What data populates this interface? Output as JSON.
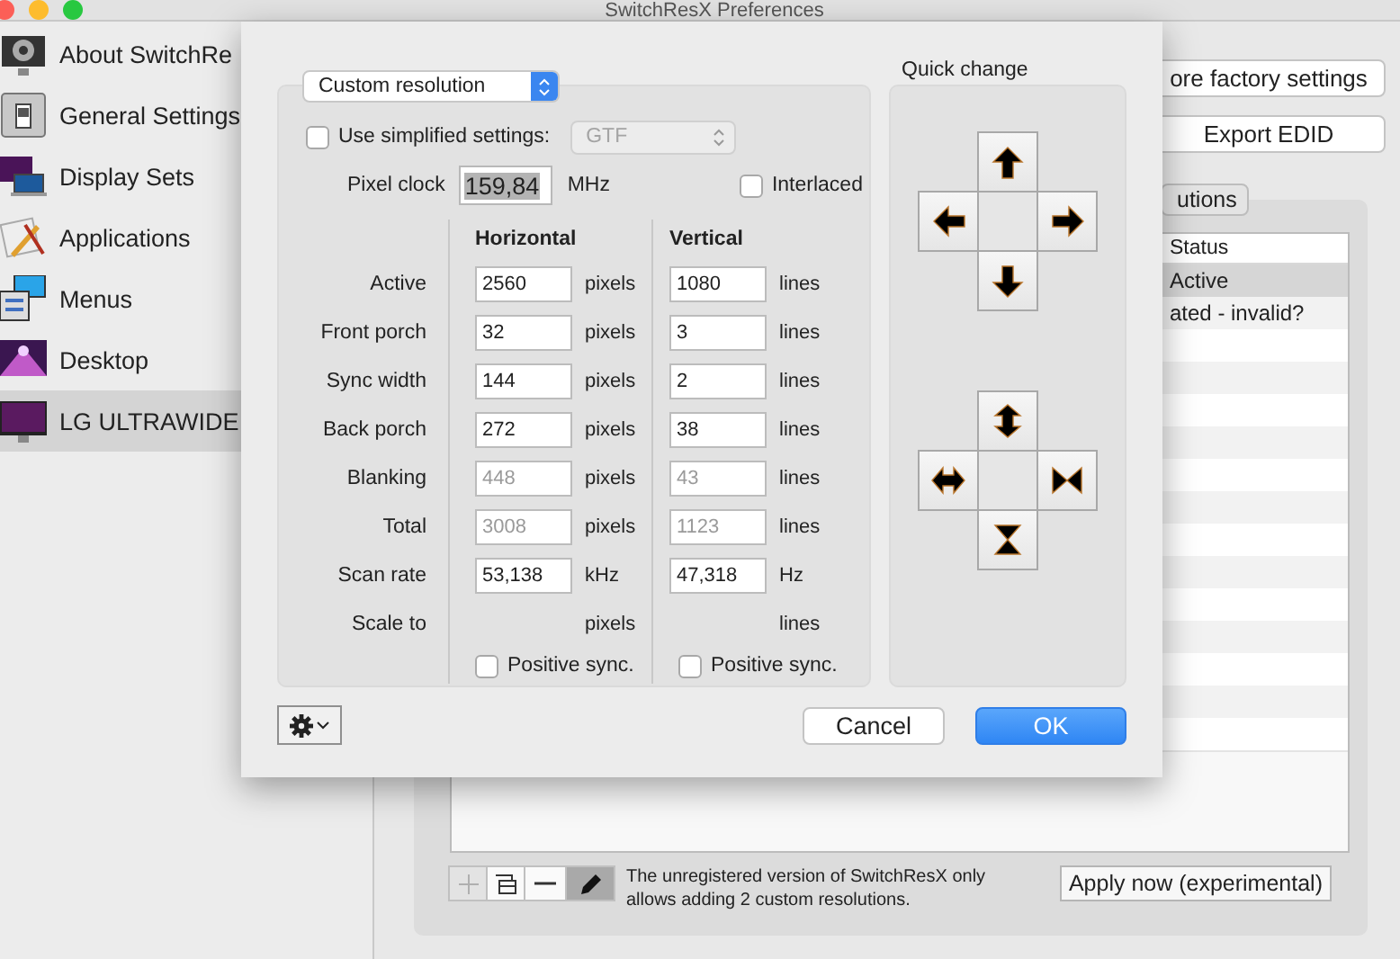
{
  "window": {
    "title": "SwitchResX Preferences"
  },
  "sidebar": {
    "items": [
      {
        "label": "About SwitchRe",
        "kind": "about",
        "selected": false
      },
      {
        "label": "General Settings",
        "kind": "general",
        "selected": false
      },
      {
        "label": "Display Sets",
        "kind": "sets",
        "selected": false
      },
      {
        "label": "Applications",
        "kind": "apps",
        "selected": false
      },
      {
        "label": "Menus",
        "kind": "menus",
        "selected": false
      },
      {
        "label": "Desktop",
        "kind": "desktop",
        "selected": false
      },
      {
        "label": "LG ULTRAWIDE",
        "kind": "display",
        "selected": true
      }
    ]
  },
  "main": {
    "buttons": [
      "ore factory settings",
      "Export EDID"
    ],
    "tab": {
      "label": "utions",
      "selected": true
    },
    "table": {
      "status_header": "Status",
      "rows": [
        {
          "status": "Active",
          "selected": true
        },
        {
          "status": "ated - invalid?",
          "selected": false
        }
      ]
    },
    "toolbar": [
      {
        "kind": "add",
        "disabled": true,
        "pressed": false
      },
      {
        "kind": "duplicate",
        "disabled": false,
        "pressed": false
      },
      {
        "kind": "remove",
        "disabled": false,
        "pressed": false
      },
      {
        "kind": "edit",
        "disabled": false,
        "pressed": true
      }
    ],
    "note": "The unregistered version of SwitchResX only allows adding 2 custom resolutions.",
    "apply_button": "Apply now (experimental)"
  },
  "sheet": {
    "mode_popup": "Custom resolution",
    "simplified": {
      "label": "Use simplified settings:",
      "checked": false,
      "select": "GTF",
      "disabled": true
    },
    "pixel_clock": {
      "label": "Pixel clock",
      "value": "159,84",
      "unit": "MHz",
      "selected": true
    },
    "interlaced": {
      "label": "Interlaced",
      "checked": false
    },
    "headers": [
      "Horizontal",
      "Vertical"
    ],
    "rows": [
      {
        "label": "Active",
        "h": {
          "value": "2560",
          "unit": "pixels",
          "disabled": false
        },
        "v": {
          "value": "1080",
          "unit": "lines",
          "disabled": false
        }
      },
      {
        "label": "Front porch",
        "h": {
          "value": "32",
          "unit": "pixels",
          "disabled": false
        },
        "v": {
          "value": "3",
          "unit": "lines",
          "disabled": false
        }
      },
      {
        "label": "Sync width",
        "h": {
          "value": "144",
          "unit": "pixels",
          "disabled": false
        },
        "v": {
          "value": "2",
          "unit": "lines",
          "disabled": false
        }
      },
      {
        "label": "Back porch",
        "h": {
          "value": "272",
          "unit": "pixels",
          "disabled": false
        },
        "v": {
          "value": "38",
          "unit": "lines",
          "disabled": false
        }
      },
      {
        "label": "Blanking",
        "h": {
          "value": "448",
          "unit": "pixels",
          "disabled": true
        },
        "v": {
          "value": "43",
          "unit": "lines",
          "disabled": true
        }
      },
      {
        "label": "Total",
        "h": {
          "value": "3008",
          "unit": "pixels",
          "disabled": true
        },
        "v": {
          "value": "1123",
          "unit": "lines",
          "disabled": true
        }
      },
      {
        "label": "Scan rate",
        "h": {
          "value": "53,138",
          "unit": "kHz",
          "disabled": false
        },
        "v": {
          "value": "47,318",
          "unit": "Hz",
          "disabled": false
        }
      },
      {
        "label": "Scale to",
        "h": {
          "unit": "pixels"
        },
        "v": {
          "unit": "lines"
        }
      }
    ],
    "sync": [
      {
        "label": "Positive sync.",
        "checked": false
      },
      {
        "label": "Positive sync.",
        "checked": false
      }
    ],
    "quick_change": {
      "title": "Quick change"
    },
    "cancel": "Cancel",
    "ok": "OK"
  }
}
